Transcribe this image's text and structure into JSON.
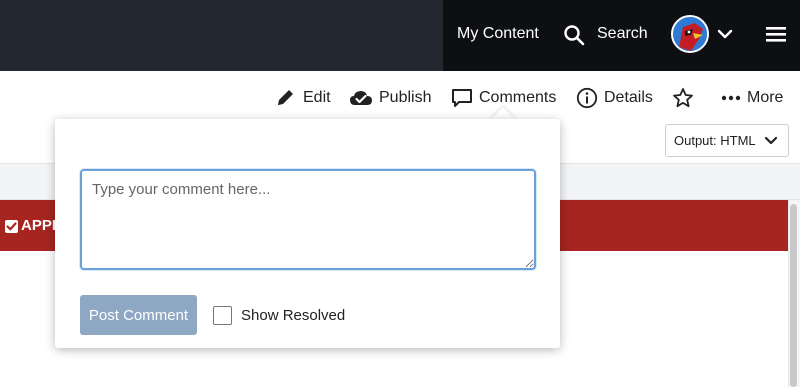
{
  "header": {
    "my_content": "My Content",
    "search": "Search"
  },
  "toolbar": {
    "edit": "Edit",
    "publish": "Publish",
    "comments": "Comments",
    "details": "Details",
    "more": "More",
    "output": "Output: HTML"
  },
  "banner": {
    "text": "APPL"
  },
  "comments_popover": {
    "placeholder": "Type your comment here...",
    "post_button": "Post Comment",
    "show_resolved": "Show Resolved"
  },
  "colors": {
    "header_bg": "#232730",
    "banner_bg": "#a72520",
    "post_button_bg": "#8ea8c3",
    "focus_border": "#6aa0d8"
  },
  "icons": {
    "search": "search-icon",
    "chevron": "chevron-down-icon",
    "menu": "hamburger-menu-icon",
    "edit": "pencil-icon",
    "publish": "cloud-check-icon",
    "comments": "speech-bubble-icon",
    "details": "info-icon",
    "favorite": "star-icon",
    "more": "ellipsis-icon"
  }
}
